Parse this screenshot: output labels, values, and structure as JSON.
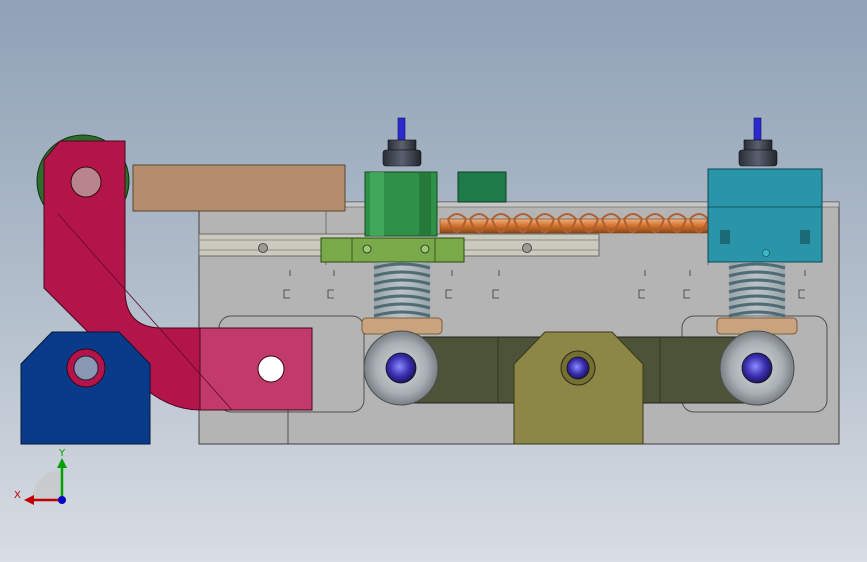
{
  "view": {
    "background_top": "#8fa2b6",
    "background_bottom": "#d9dde4"
  },
  "triad": {
    "x_label": "X",
    "y_label": "Y",
    "x_color": "#c00000",
    "y_color": "#00a000",
    "z_color": "#0000c0"
  },
  "parts": [
    {
      "name": "base-plate",
      "color": "#b4b4b4"
    },
    {
      "name": "crank-arm",
      "color": "#b4124a"
    },
    {
      "name": "blue-bracket",
      "color": "#0a3c8c"
    },
    {
      "name": "olive-bracket",
      "color": "#8c8c46"
    },
    {
      "name": "green-block",
      "color": "#288c41"
    },
    {
      "name": "teal-block",
      "color": "#2891a0"
    },
    {
      "name": "guide-rail",
      "color": "#c8c8bc"
    },
    {
      "name": "copper-spring",
      "color": "#d2783c"
    },
    {
      "name": "tan-bar",
      "color": "#b48c6e"
    },
    {
      "name": "dark-track",
      "color": "#50553c"
    }
  ]
}
